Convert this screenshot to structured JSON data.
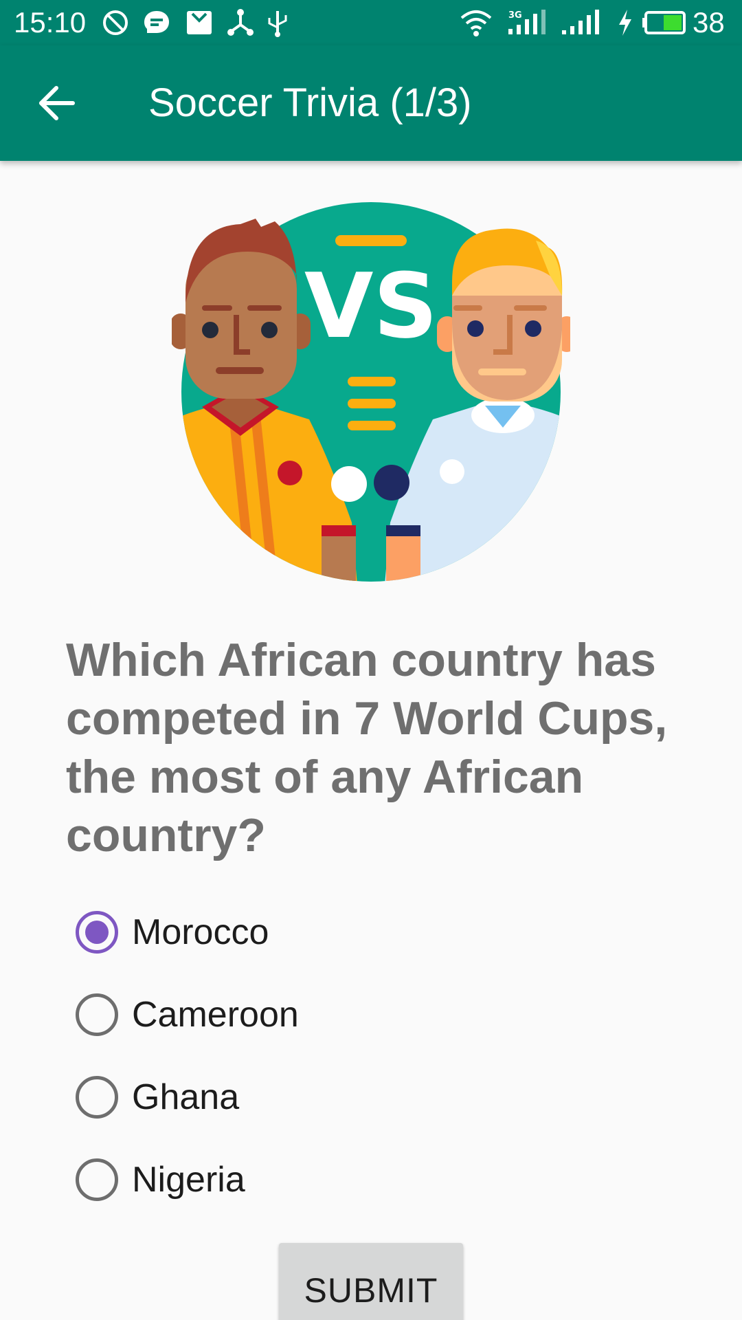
{
  "status_bar": {
    "time": "15:10",
    "battery_percent": "38",
    "icons": [
      "do-not-disturb-icon",
      "message-icon",
      "mail-icon",
      "share-icon",
      "usb-icon",
      "wifi-icon",
      "signal-3g-icon",
      "signal-icon",
      "charging-icon",
      "battery-icon"
    ]
  },
  "app_bar": {
    "title": "Soccer Trivia (1/3)",
    "back_icon": "arrow-back-icon"
  },
  "illustration": {
    "vs_text": "VS"
  },
  "question": {
    "text": "Which African country has competed in 7 World Cups, the most of any African country?"
  },
  "options": [
    {
      "label": "Morocco",
      "selected": true
    },
    {
      "label": "Cameroon",
      "selected": false
    },
    {
      "label": "Ghana",
      "selected": false
    },
    {
      "label": "Nigeria",
      "selected": false
    }
  ],
  "submit": {
    "label": "SUBMIT"
  },
  "colors": {
    "primary": "#00836f",
    "radio_selected": "#7e57c2",
    "question_text": "#6f6f6f",
    "button_bg": "#d6d7d7"
  }
}
